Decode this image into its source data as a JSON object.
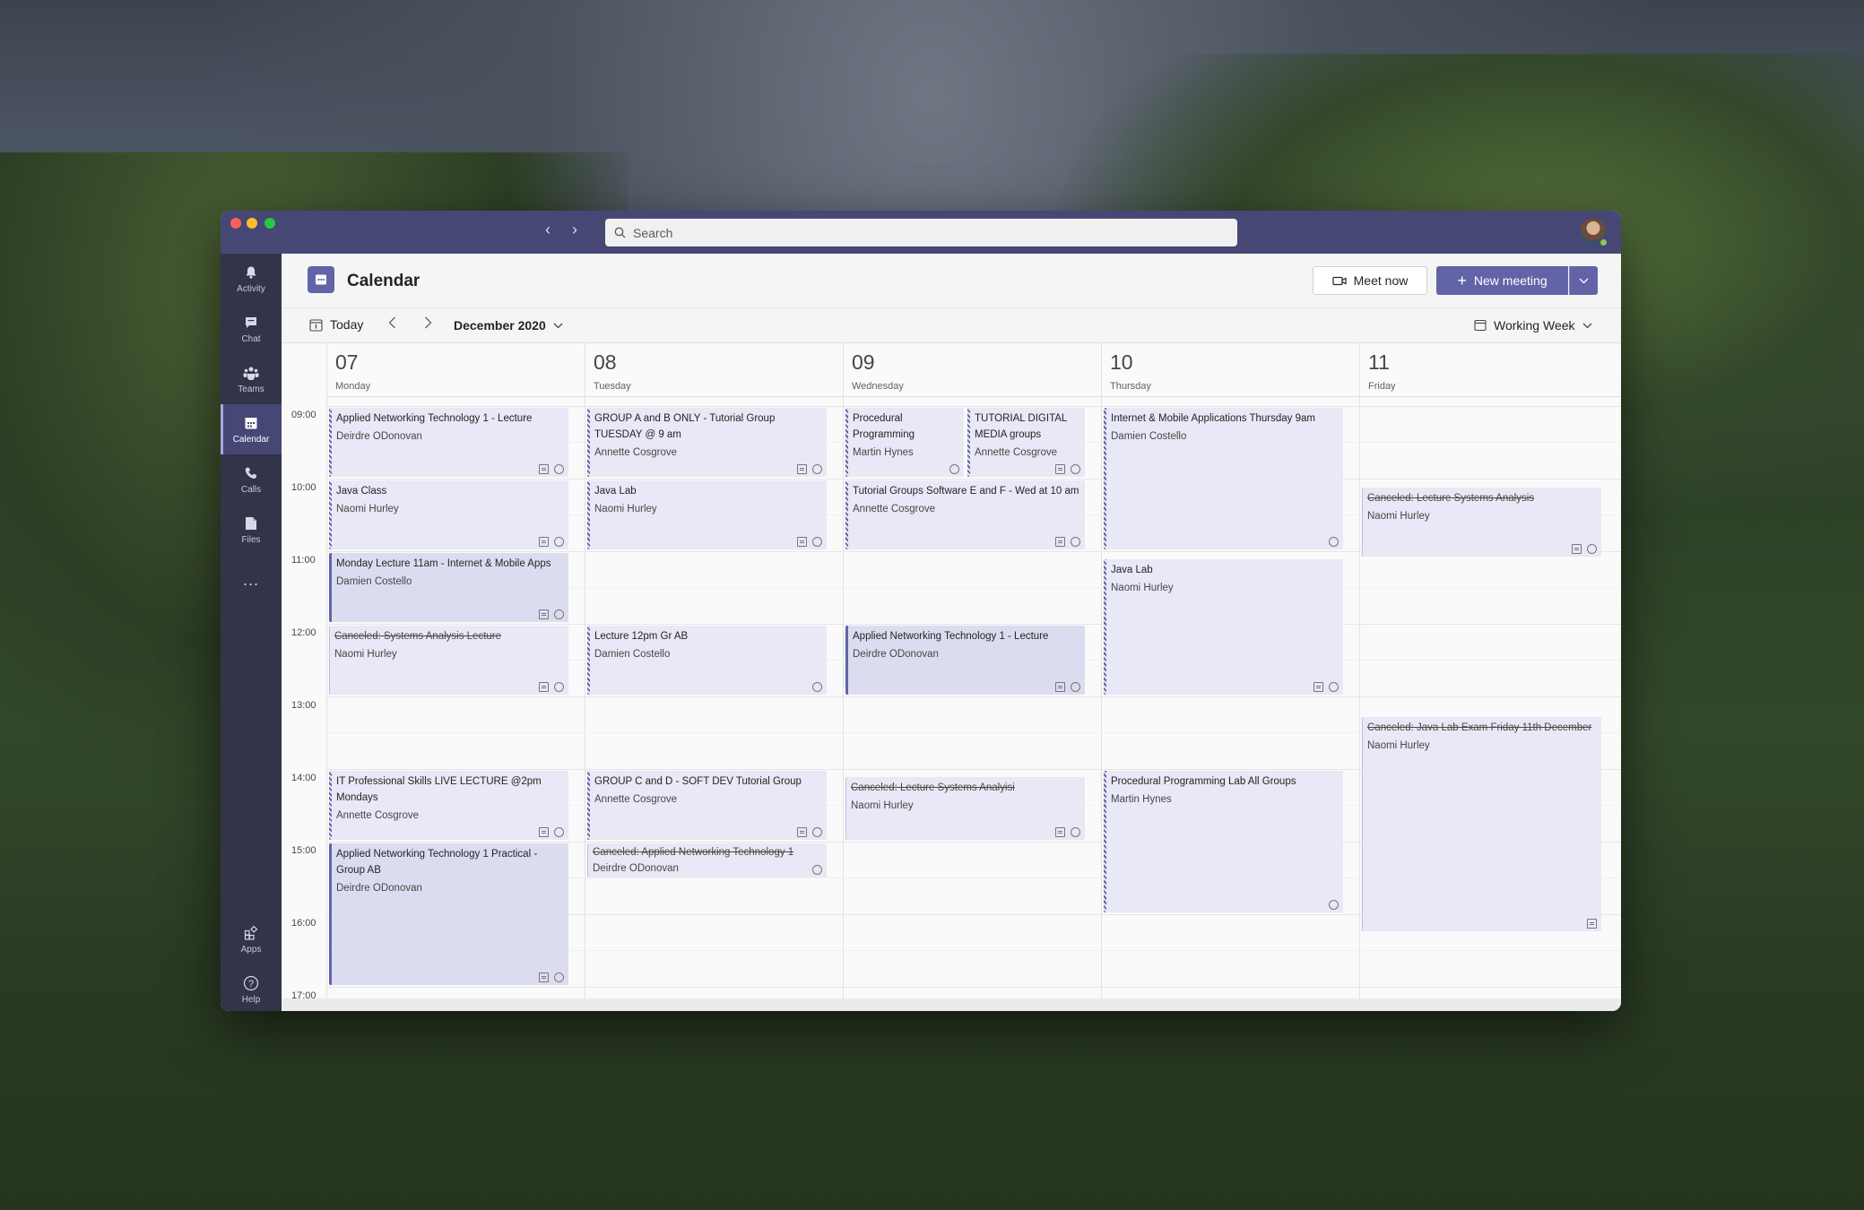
{
  "app": {
    "search_placeholder": "Search",
    "rail": [
      {
        "label": "Activity"
      },
      {
        "label": "Chat"
      },
      {
        "label": "Teams"
      },
      {
        "label": "Calendar"
      },
      {
        "label": "Calls"
      },
      {
        "label": "Files"
      },
      {
        "label": "..."
      },
      {
        "label": "Apps"
      },
      {
        "label": "Help"
      }
    ]
  },
  "calendar": {
    "title": "Calendar",
    "meet_now": "Meet now",
    "new_meeting": "New meeting",
    "today": "Today",
    "month": "December 2020",
    "view": "Working Week",
    "days": [
      {
        "num": "07",
        "name": "Monday"
      },
      {
        "num": "08",
        "name": "Tuesday"
      },
      {
        "num": "09",
        "name": "Wednesday"
      },
      {
        "num": "10",
        "name": "Thursday"
      },
      {
        "num": "11",
        "name": "Friday"
      }
    ],
    "hours": [
      "09:00",
      "10:00",
      "11:00",
      "12:00",
      "13:00",
      "14:00",
      "15:00",
      "16:00",
      "17:00"
    ],
    "events": {
      "e1": {
        "title": "Applied Networking Technology 1 - Lecture",
        "organizer": "Deirdre ODonovan"
      },
      "e2": {
        "title": "Java Class",
        "organizer": "Naomi Hurley"
      },
      "e3": {
        "title": "Monday Lecture 11am - Internet & Mobile Apps",
        "organizer": "Damien Costello"
      },
      "e4": {
        "title": "Canceled: Systems Analysis Lecture",
        "organizer": "Naomi Hurley"
      },
      "e5": {
        "title": "IT Professional Skills LIVE LECTURE @2pm Mondays",
        "organizer": "Annette Cosgrove"
      },
      "e6": {
        "title": "Applied Networking Technology 1 Practical - Group AB",
        "organizer": "Deirdre ODonovan"
      },
      "e7": {
        "title": "GROUP A and B ONLY - Tutorial Group TUESDAY @ 9 am",
        "organizer": "Annette Cosgrove"
      },
      "e8": {
        "title": "Java Lab",
        "organizer": "Naomi Hurley"
      },
      "e9": {
        "title": "Lecture 12pm Gr AB",
        "organizer": "Damien Costello"
      },
      "e10": {
        "title": "GROUP C and D - SOFT DEV Tutorial Group",
        "organizer": "Annette Cosgrove"
      },
      "e11": {
        "title": "Canceled: Applied Networking Technology 1",
        "organizer": "Deirdre ODonovan"
      },
      "e12": {
        "title": "Procedural Programming",
        "organizer": "Martin Hynes"
      },
      "e13": {
        "title": "TUTORIAL DIGITAL MEDIA groups",
        "organizer": "Annette Cosgrove"
      },
      "e14": {
        "title": "Tutorial Groups Software E and F - Wed at 10 am",
        "organizer": "Annette Cosgrove"
      },
      "e15": {
        "title": "Applied Networking Technology 1 - Lecture",
        "organizer": "Deirdre ODonovan"
      },
      "e16": {
        "title": "Canceled: Lecture Systems Analyisi",
        "organizer": "Naomi Hurley"
      },
      "e17": {
        "title": "Internet & Mobile Applications Thursday 9am",
        "organizer": "Damien Costello"
      },
      "e18": {
        "title": "Java Lab",
        "organizer": "Naomi Hurley"
      },
      "e19": {
        "title": "Procedural Programming Lab All Groups",
        "organizer": "Martin Hynes"
      },
      "e20": {
        "title": "Canceled: Lecture Systems Analysis",
        "organizer": "Naomi Hurley"
      },
      "e21": {
        "title": "Canceled: Java Lab Exam Friday 11th December",
        "organizer": "Naomi Hurley"
      }
    }
  },
  "colors": {
    "accent": "#6264a7",
    "titlebar": "#464775",
    "rail": "#33344a",
    "event_bg": "#e8e8f6"
  }
}
